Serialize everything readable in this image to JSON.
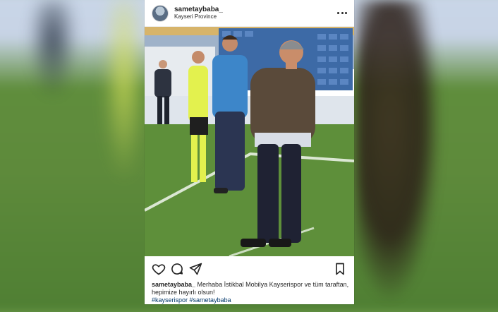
{
  "post": {
    "username": "sametaybaba_",
    "location": "Kayseri Province",
    "caption_username": "sametaybaba_",
    "caption_text": " Merhaba İstikbal Mobilya Kayserispor ve tüm taraftan, hepimize hayırlı olsun!",
    "hashtags": [
      "#kayserispor",
      "#sametaybaba"
    ]
  },
  "icons": {
    "more": "more-horizontal-icon",
    "like": "heart-icon",
    "comment": "comment-icon",
    "share": "send-icon",
    "save": "bookmark-icon"
  },
  "colors": {
    "text": "#262626",
    "hashtag": "#00376b",
    "pitch": "#5e8f3a"
  }
}
